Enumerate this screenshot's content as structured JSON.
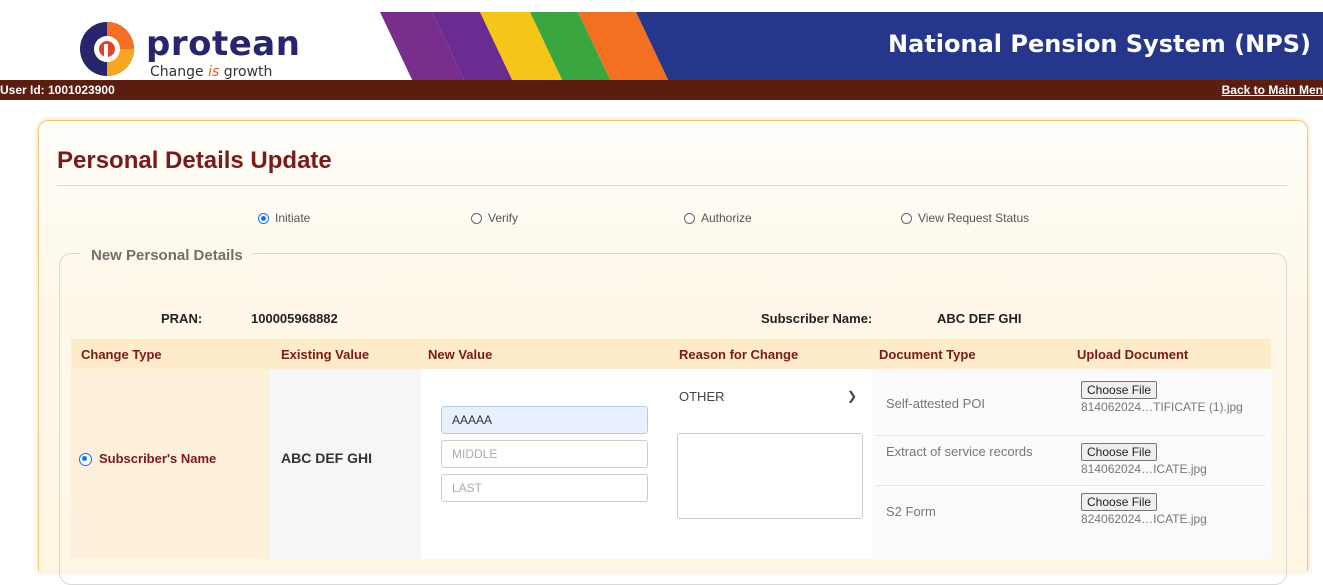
{
  "header": {
    "brand_name": "protean",
    "brand_tagline_pre": "Change ",
    "brand_tagline_is": "is",
    "brand_tagline_post": " growth",
    "system_title": "National Pension System (NPS)",
    "user_id": "User Id: 1001023900",
    "back_link": "Back to Main Men"
  },
  "page": {
    "title": "Personal Details Update",
    "actions": [
      {
        "label": "Initiate",
        "selected": true
      },
      {
        "label": "Verify",
        "selected": false
      },
      {
        "label": "Authorize",
        "selected": false
      },
      {
        "label": "View Request Status",
        "selected": false
      }
    ],
    "section_legend": "New Personal Details"
  },
  "subscriber": {
    "pran_label": "PRAN:",
    "pran_value": "100005968882",
    "name_label": "Subscriber Name:",
    "name_value": "ABC DEF GHI"
  },
  "table": {
    "headers": [
      "Change Type",
      "Existing Value",
      "New Value",
      "Reason for Change",
      "Document Type",
      "Upload Document"
    ],
    "row": {
      "change_type": "Subscriber's Name",
      "change_type_selected": true,
      "existing_value": "ABC DEF GHI",
      "new_first": "AAAAA",
      "new_middle_placeholder": "MIDDLE",
      "new_last_placeholder": "LAST",
      "reason": "OTHER",
      "reason_text": ""
    },
    "documents": [
      {
        "type": "Self-attested POI",
        "button": "Choose File",
        "file": "814062024…TIFICATE (1).jpg"
      },
      {
        "type": "Extract of service records",
        "button": "Choose File",
        "file": "814062024…ICATE.jpg"
      },
      {
        "type": "S2 Form",
        "button": "Choose File",
        "file": "824062024…ICATE.jpg"
      }
    ]
  },
  "colors": {
    "title": "#7a1a1a",
    "user_bar": "#5a1e10",
    "header_blue": "#2b3b8f",
    "radio_accent": "#1a73e8",
    "table_header_bg": "#fdebc9"
  }
}
